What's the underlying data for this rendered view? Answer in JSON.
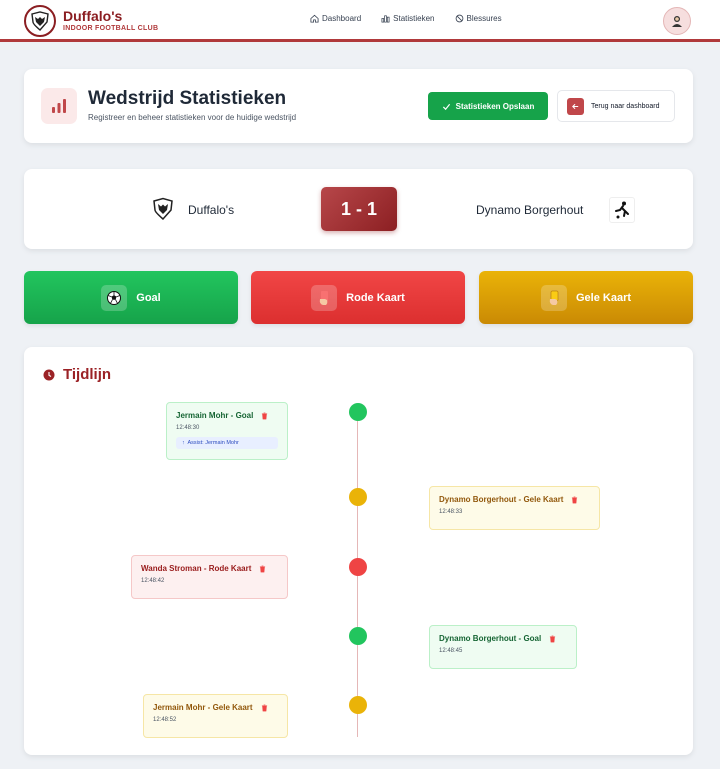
{
  "brand": {
    "name": "Duffalo's",
    "subtitle": "INDOOR FOOTBALL CLUB"
  },
  "nav": {
    "items": [
      {
        "label": "Dashboard",
        "icon": "home-icon"
      },
      {
        "label": "Statistieken",
        "icon": "bar-chart-icon"
      },
      {
        "label": "Blessures",
        "icon": "ban-icon"
      }
    ]
  },
  "header": {
    "title": "Wedstrijd Statistieken",
    "subtitle": "Registreer en beheer statistieken voor de huidige wedstrijd",
    "save_label": "Statistieken Opslaan",
    "back_label": "Terug naar dashboard"
  },
  "match": {
    "home_team": "Duffalo's",
    "away_team": "Dynamo Borgerhout",
    "score": "1 - 1"
  },
  "actions": {
    "goal": "Goal",
    "red_card": "Rode Kaart",
    "yellow_card": "Gele Kaart"
  },
  "timeline": {
    "title": "Tijdlijn",
    "events": [
      {
        "title": "Jermain Mohr - Goal",
        "time": "12:48:30",
        "assist": "Assist: Jermain Mohr",
        "type": "goal"
      },
      {
        "title": "Dynamo Borgerhout - Gele Kaart",
        "time": "12:48:33",
        "type": "yellow"
      },
      {
        "title": "Wanda Stroman - Rode Kaart",
        "time": "12:48:42",
        "type": "red"
      },
      {
        "title": "Dynamo Borgerhout - Goal",
        "time": "12:48:45",
        "type": "goal"
      },
      {
        "title": "Jermain Mohr - Gele Kaart",
        "time": "12:48:52",
        "type": "yellow"
      }
    ]
  },
  "colors": {
    "brand": "#8b1e22",
    "goal": "#22c55e",
    "red": "#ef4444",
    "yellow": "#eab308"
  }
}
